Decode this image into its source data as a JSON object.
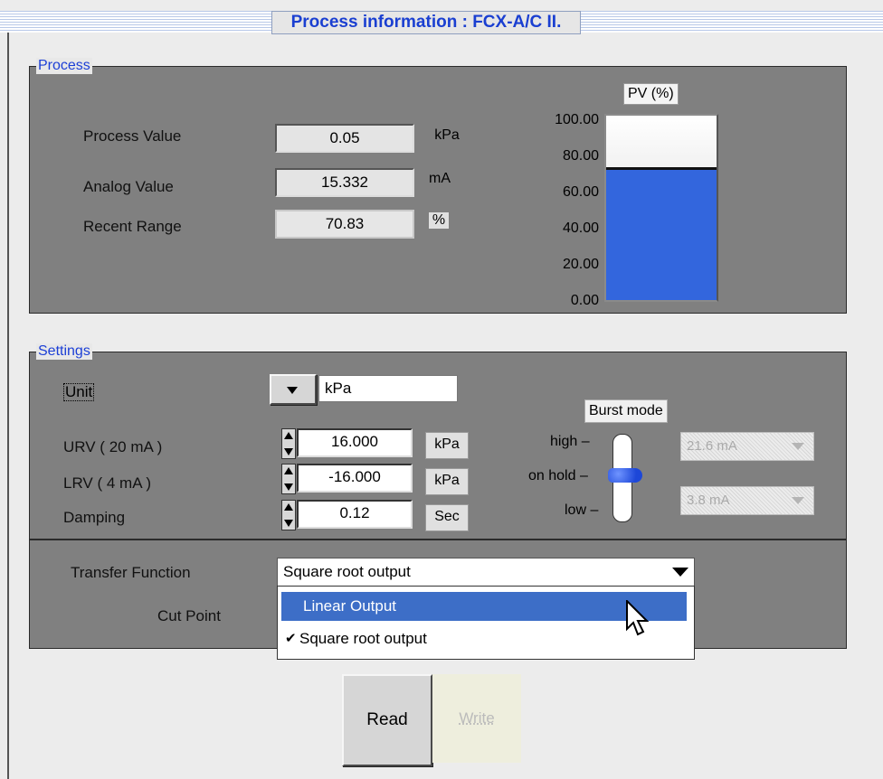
{
  "window": {
    "title": "Process information : FCX-A/C II."
  },
  "process": {
    "group_label": "Process",
    "process_value": {
      "label": "Process Value",
      "value": "0.05",
      "unit": "kPa"
    },
    "analog_value": {
      "label": "Analog Value",
      "value": "15.332",
      "unit": "mA"
    },
    "recent_range": {
      "label": "Recent Range",
      "value": "70.83",
      "unit": "%"
    },
    "pv_gauge": {
      "label": "PV (%)",
      "ticks": [
        "100.00",
        "80.00",
        "60.00",
        "40.00",
        "20.00",
        "0.00"
      ],
      "level_percent": 70.83,
      "fill_color": "#3366dd"
    }
  },
  "settings": {
    "group_label": "Settings",
    "unit": {
      "label": "Unit",
      "value": "kPa"
    },
    "urv": {
      "label": "URV ( 20 mA )",
      "value": "16.000",
      "unit": "kPa"
    },
    "lrv": {
      "label": "LRV ( 4 mA )",
      "value": "-16.000",
      "unit": "kPa"
    },
    "damping": {
      "label": "Damping",
      "value": "0.12",
      "unit": "Sec"
    },
    "burst_mode": {
      "label": "Burst mode",
      "positions": [
        "high",
        "on hold",
        "low"
      ],
      "selected": "on hold",
      "high_value": "21.6 mA",
      "low_value": "3.8 mA"
    },
    "transfer_function": {
      "label": "Transfer Function",
      "value": "Square root output",
      "options": [
        "Linear Output",
        "Square root output"
      ],
      "highlighted": "Linear Output",
      "checked": "Square root output"
    },
    "cut_point": {
      "label": "Cut Point"
    }
  },
  "buttons": {
    "read": "Read",
    "write": "Write"
  },
  "colors": {
    "panel": "#808080",
    "accent_blue": "#1c3fd6",
    "highlight": "#3d6ec7"
  }
}
